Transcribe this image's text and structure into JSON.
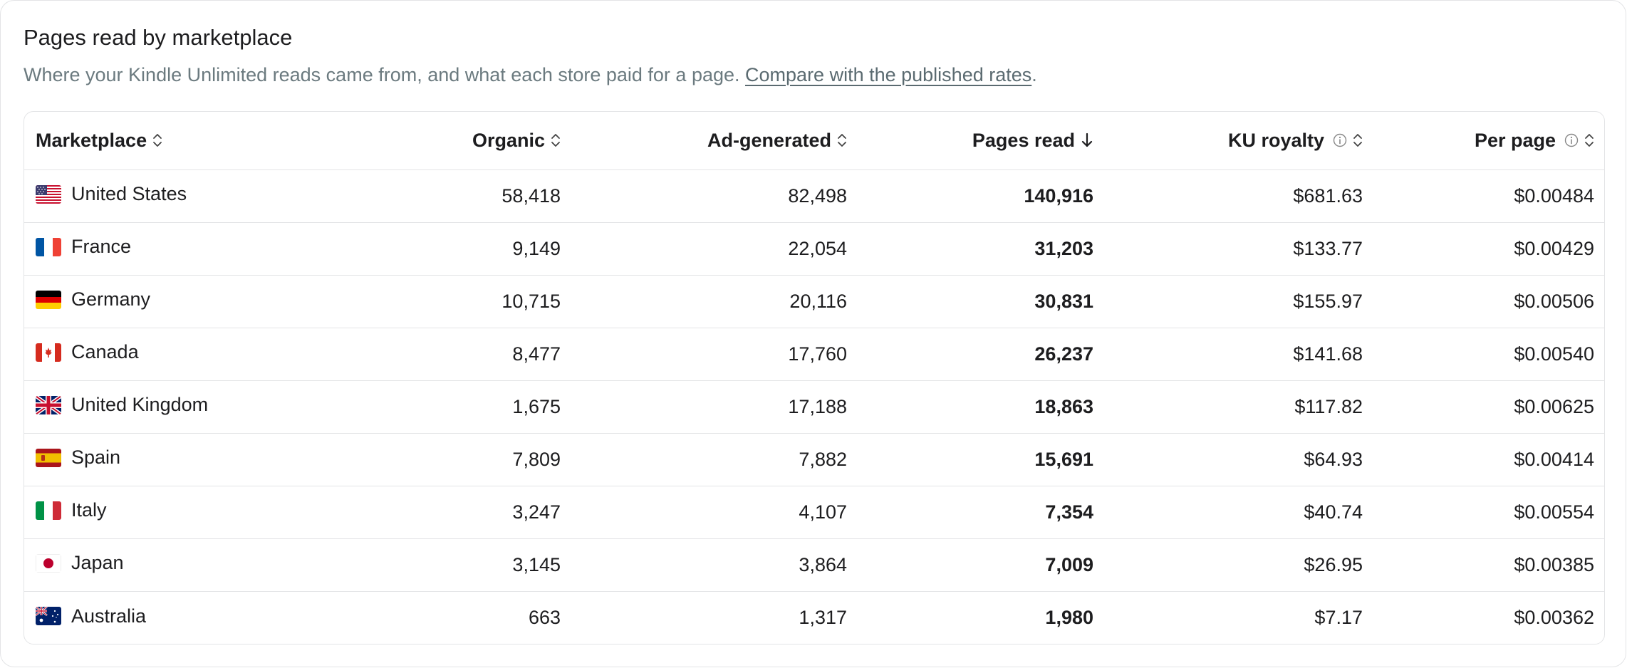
{
  "header": {
    "title": "Pages read by marketplace",
    "subtitle_text": "Where your Kindle Unlimited reads came from, and what each store paid for a page.",
    "subtitle_link": "Compare with the published rates",
    "subtitle_end": "."
  },
  "table": {
    "columns": [
      {
        "label": "Marketplace",
        "icon": "sort-icon"
      },
      {
        "label": "Organic",
        "icon": "sort-icon"
      },
      {
        "label": "Ad-generated",
        "icon": "sort-icon"
      },
      {
        "label": "Pages read",
        "icon": "arrow-down-icon"
      },
      {
        "label": "KU royalty",
        "icon": "sort-icon",
        "info": true
      },
      {
        "label": "Per page",
        "icon": "sort-icon",
        "info": true
      }
    ],
    "rows": [
      {
        "flag": "us",
        "marketplace": "United States",
        "organic": "58,418",
        "ad_generated": "82,498",
        "pages_read": "140,916",
        "ku_royalty": "$681.63",
        "per_page": "$0.00484"
      },
      {
        "flag": "fr",
        "marketplace": "France",
        "organic": "9,149",
        "ad_generated": "22,054",
        "pages_read": "31,203",
        "ku_royalty": "$133.77",
        "per_page": "$0.00429"
      },
      {
        "flag": "de",
        "marketplace": "Germany",
        "organic": "10,715",
        "ad_generated": "20,116",
        "pages_read": "30,831",
        "ku_royalty": "$155.97",
        "per_page": "$0.00506"
      },
      {
        "flag": "ca",
        "marketplace": "Canada",
        "organic": "8,477",
        "ad_generated": "17,760",
        "pages_read": "26,237",
        "ku_royalty": "$141.68",
        "per_page": "$0.00540"
      },
      {
        "flag": "gb",
        "marketplace": "United Kingdom",
        "organic": "1,675",
        "ad_generated": "17,188",
        "pages_read": "18,863",
        "ku_royalty": "$117.82",
        "per_page": "$0.00625"
      },
      {
        "flag": "es",
        "marketplace": "Spain",
        "organic": "7,809",
        "ad_generated": "7,882",
        "pages_read": "15,691",
        "ku_royalty": "$64.93",
        "per_page": "$0.00414"
      },
      {
        "flag": "it",
        "marketplace": "Italy",
        "organic": "3,247",
        "ad_generated": "4,107",
        "pages_read": "7,354",
        "ku_royalty": "$40.74",
        "per_page": "$0.00554"
      },
      {
        "flag": "jp",
        "marketplace": "Japan",
        "organic": "3,145",
        "ad_generated": "3,864",
        "pages_read": "7,009",
        "ku_royalty": "$26.95",
        "per_page": "$0.00385"
      },
      {
        "flag": "au",
        "marketplace": "Australia",
        "organic": "663",
        "ad_generated": "1,317",
        "pages_read": "1,980",
        "ku_royalty": "$7.17",
        "per_page": "$0.00362"
      }
    ]
  }
}
